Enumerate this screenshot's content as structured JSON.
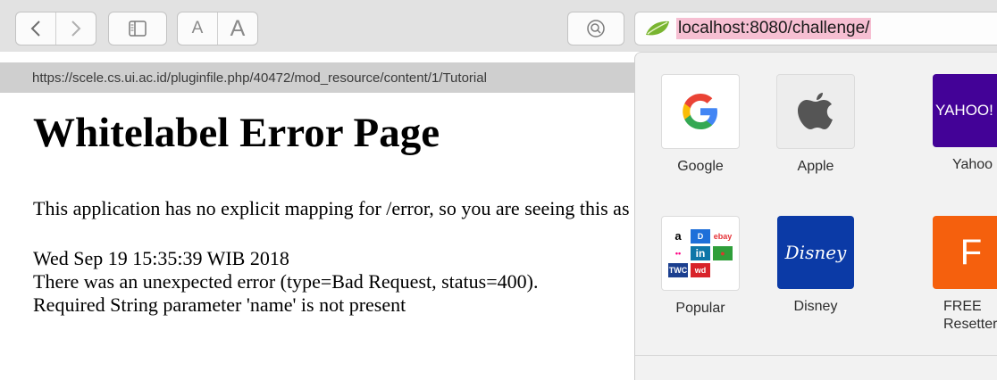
{
  "toolbar": {
    "text_size_small": "A",
    "text_size_large": "A",
    "back_icon": "chevron-left-icon",
    "forward_icon": "chevron-right-icon",
    "sidebar_icon": "sidebar-icon",
    "search_icon": "search-icon"
  },
  "address": {
    "url": "localhost:8080/challenge/",
    "site_icon": "spring-leaf-icon"
  },
  "status_bar": {
    "url": "https://scele.cs.ui.ac.id/pluginfile.php/40472/mod_resource/content/1/Tutorial"
  },
  "page": {
    "title": "Whitelabel Error Page",
    "message": "This application has no explicit mapping for /error, so you are seeing this as a fallback.",
    "timestamp": "Wed Sep 19 15:35:39 WIB 2018",
    "error": "There was an unexpected error (type=Bad Request, status=400).",
    "detail": "Required String parameter 'name' is not present"
  },
  "favorites": [
    {
      "label": "Google",
      "icon": "google-icon"
    },
    {
      "label": "Apple",
      "icon": "apple-icon"
    },
    {
      "label": "Yahoo",
      "icon": "yahoo-icon",
      "tile_text": "YAHOO!"
    },
    {
      "label": "Popular",
      "icon": "popular-sites-icon"
    },
    {
      "label": "Disney",
      "icon": "disney-icon",
      "tile_text": "Disney"
    },
    {
      "label": "FREE Resetter...",
      "icon": "free-resetter-icon",
      "tile_text": "F"
    }
  ],
  "popular_tiles": [
    "a",
    "D",
    "ebay",
    "••",
    "in",
    "●",
    "TWC",
    "wd",
    ""
  ],
  "colors": {
    "address_highlight": "#f6bfd2",
    "yahoo": "#430297",
    "disney": "#0b3aa6",
    "free_resetter": "#f5600d"
  }
}
